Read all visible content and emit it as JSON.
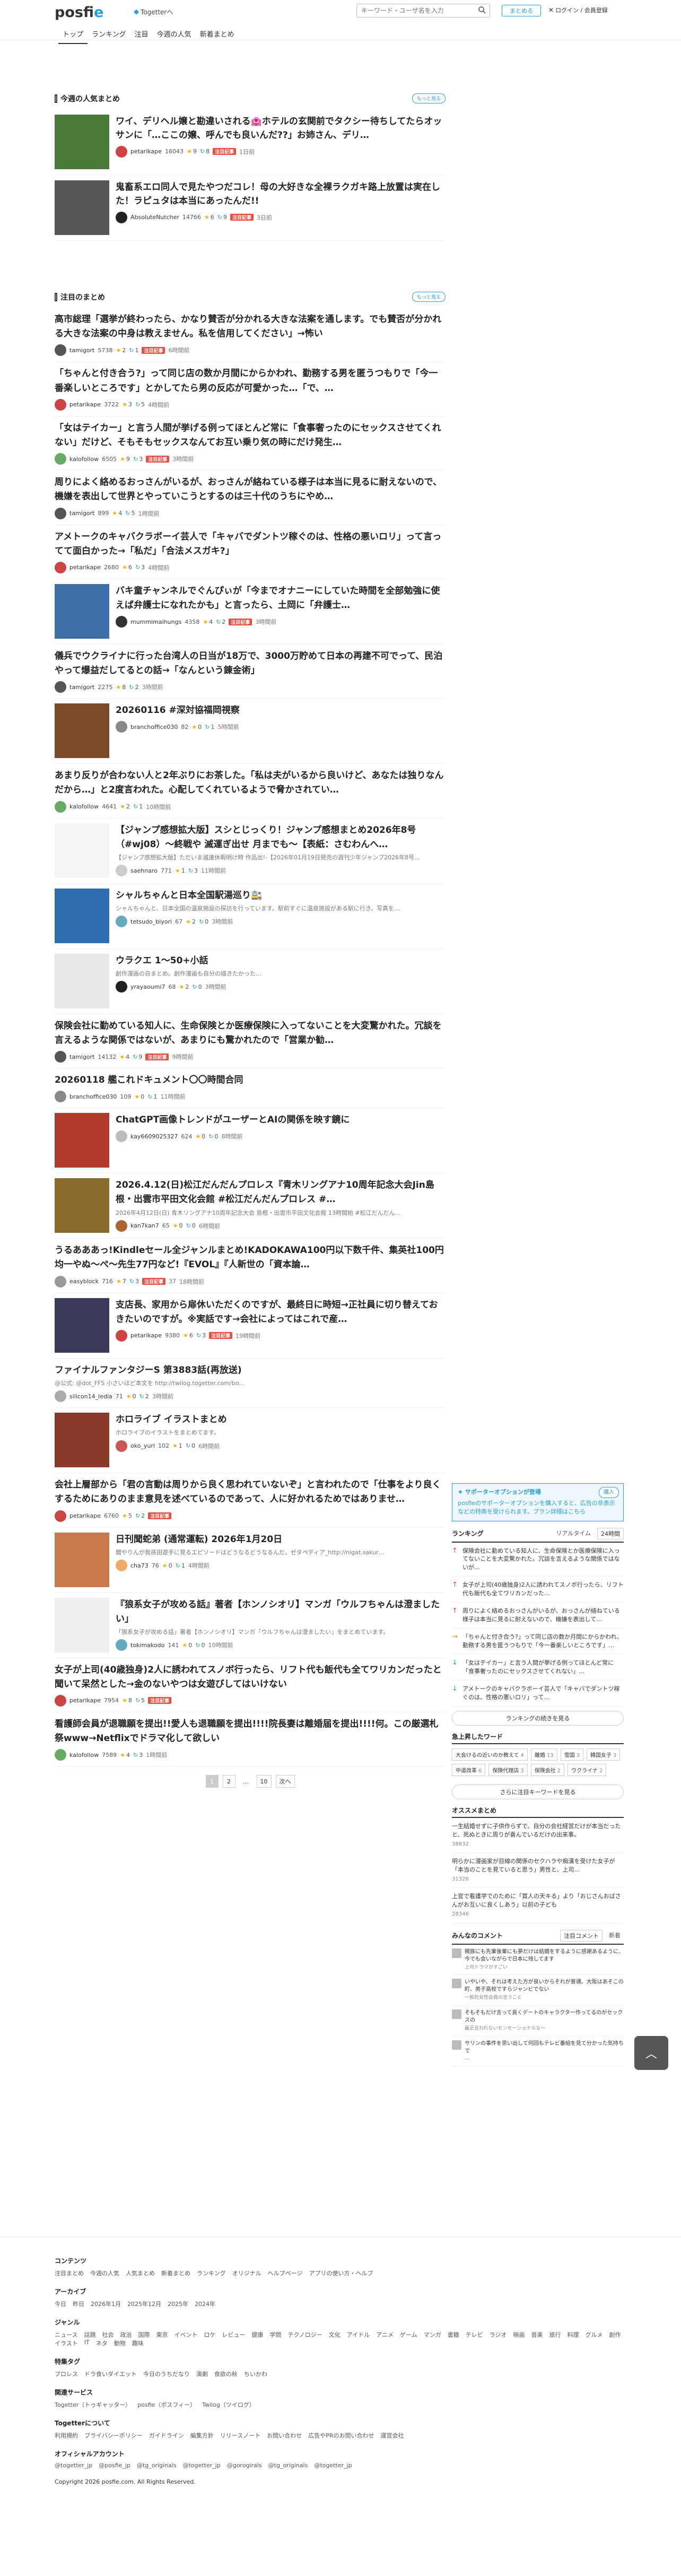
{
  "header": {
    "logo_text_a": "posfi",
    "logo_text_b": "e",
    "togetter_link": "Togetterへ",
    "search_placeholder": "キーワード・ユーザ名を入力",
    "follow_label": "まとめる",
    "login_label": "ログイン / 会員登録",
    "nav": [
      "トップ",
      "ランキング",
      "注目",
      "今週の人気",
      "新着まとめ"
    ]
  },
  "weekly": {
    "title": "今週の人気まとめ",
    "more": "もっと見る",
    "items": [
      {
        "title": "ワイ、デリヘル嬢と勘違いされる🏩ホテルの玄関前でタクシー待ちしてたらオッサンに「…ここの嬢、呼んでも良いんだ??」お姉さん、デリ…",
        "user": "petarikape",
        "views": "16043",
        "fav": "9",
        "rt": "8",
        "hot": "注目記事",
        "time": "1日前",
        "thumb": "#4a7a3a",
        "avatar": "#c44"
      },
      {
        "title": "鬼畜系エロ同人で見たやつだコレ！母の大好きな全裸ラクガキ路上放置は実在した！ラピュタは本当にあったんだ!!",
        "user": "AbsoluteNutcher",
        "views": "14766",
        "fav": "6",
        "rt": "9",
        "hot": "注目記事",
        "time": "3日前",
        "thumb": "#555",
        "avatar": "#222"
      }
    ]
  },
  "notable": {
    "title": "注目のまとめ",
    "more": "もっと見る",
    "items": [
      {
        "title": "高市総理「選挙が終わったら、かなり賛否が分かれる大きな法案を通します。でも賛否が分かれる大きな法案の中身は教えません。私を信用してください」→怖い",
        "user": "tamigort",
        "views": "5738",
        "fav": "2",
        "rt": "1",
        "hot": "注目記事",
        "time": "6時間前",
        "avatar": "#555"
      },
      {
        "title": "「ちゃんと付き合う?」って同じ店の数か月間にからかわれ、勤務する男を匿うつもりで「今一番楽しいところです」とかしてたら男の反応が可愛かった…「で、…",
        "user": "petarikape",
        "views": "3722",
        "fav": "3",
        "rt": "5",
        "hot": "",
        "time": "4時間前",
        "avatar": "#c44"
      },
      {
        "title": "「女はテイカー」と言う人間が挙げる例ってほとんど常に「食事奢ったのにセックスさせてくれない」だけど、そもそもセックスなんてお互い乗り気の時にだけ発生…",
        "user": "kalofollow",
        "views": "6505",
        "fav": "9",
        "rt": "3",
        "hot": "注目記事",
        "time": "3時間前",
        "avatar": "#6a6"
      },
      {
        "title": "周りによく絡めるおっさんがいるが、おっさんが絡ねている様子は本当に見るに耐えないので、機嫌を表出して世界とやっていこうとするのは三十代のうちにやめ…",
        "user": "tamigort",
        "views": "899",
        "fav": "4",
        "rt": "5",
        "hot": "",
        "time": "1時間前",
        "avatar": "#555"
      },
      {
        "title": "アメトークのキャバクラボーイ芸人で「キャバでダントツ稼ぐのは、性格の悪いロリ」って言ってて面白かった→「私だ」「合法メスガキ?」",
        "user": "petarikape",
        "views": "2680",
        "fav": "6",
        "rt": "3",
        "hot": "",
        "time": "4時間前",
        "avatar": "#c44"
      },
      {
        "title": "バキ童チャンネルでぐんぴぃが「今までオナニーにしていた時間を全部勉強に使えば弁護士になれたかも」と言ったら、土岡に「弁護士…",
        "user": "mummimaihungs",
        "views": "4358",
        "fav": "4",
        "rt": "2",
        "hot": "注目記事",
        "time": "3時間前",
        "avatar": "#333",
        "thumb": "#3c6fa8"
      },
      {
        "title": "儀兵でウクライナに行った台湾人の日当が18万で、3000万貯めて日本の再建不可でって、民泊やって爆益だしてるとの話→「なんという錬金術」",
        "user": "tamigort",
        "views": "2275",
        "fav": "8",
        "rt": "2",
        "hot": "",
        "time": "3時間前",
        "avatar": "#555"
      },
      {
        "title": "20260116 #深対協福岡視察",
        "user": "branchoffice030",
        "views": "82",
        "fav": "0",
        "rt": "1",
        "hot": "",
        "time": "5時間前",
        "avatar": "#888",
        "thumb": "#7a4a2a"
      },
      {
        "title": "あまり反りが合わない人と2年ぶりにお茶した。「私は夫がいるから良いけど、あなたは独りなんだから…」と2度言われた。心配してくれているようで脅かされてい…",
        "user": "kalofollow",
        "views": "4641",
        "fav": "2",
        "rt": "1",
        "hot": "",
        "time": "10時間前",
        "avatar": "#6a6"
      },
      {
        "title": "【ジャンプ感想拡大版】スシとじっくり！ジャンプ感想まとめ2026年8号（#wj08）～終戦や 滅運ぎ出せ 月までも～【表紙：さむわんへ…",
        "sub": "【ジャンプ感想拡大版】ただいま滅連休暇明け時 作品出!-【2026年01月19日発売の週刊少年ジャンプ2026年8号…",
        "user": "saehnaro",
        "views": "771",
        "fav": "1",
        "rt": "3",
        "hot": "",
        "time": "11時間前",
        "avatar": "#ccc",
        "thumb": "#f5f5f5"
      },
      {
        "title": "シャルちゃんと日本全国駅湯巡り🚉",
        "sub": "シャルちゃんと、日本全国の温泉施設の探訪を行っています。駅前すぐに温泉施設がある駅に行き、写真を…",
        "user": "tetsudo_biyori",
        "views": "67",
        "fav": "2",
        "rt": "0",
        "hot": "",
        "time": "3時間前",
        "avatar": "#6ab",
        "thumb": "#2f6fb0"
      },
      {
        "title": "ウラクエ 1～50+小話",
        "sub": "創作漫画の自まとめ。創作漫画も自分の描きたかった…",
        "user": "yrayaoumi7",
        "views": "68",
        "fav": "2",
        "rt": "0",
        "hot": "",
        "time": "3時間前",
        "avatar": "#222",
        "thumb": "#e8e8e8"
      },
      {
        "title": "保険会社に勤めている知人に、生命保険とか医療保険に入ってないことを大変驚かれた。冗談を言えるような関係ではないが、あまりにも驚かれたので「営業か勧…",
        "user": "tamigort",
        "views": "14132",
        "fav": "4",
        "rt": "9",
        "hot": "注目記事",
        "time": "9時間前",
        "avatar": "#555"
      },
      {
        "title": "20260118 艦これドキュメント〇〇時間合同",
        "user": "branchoffice030",
        "views": "109",
        "fav": "0",
        "rt": "1",
        "hot": "",
        "time": "11時間前",
        "avatar": "#888"
      },
      {
        "title": "ChatGPT画像トレンドがユーザーとAIの関係を映す鏡に",
        "user": "kay6609025327",
        "views": "624",
        "fav": "0",
        "rt": "0",
        "hot": "",
        "time": "8時間前",
        "avatar": "#bbb",
        "thumb": "#b03a2e"
      },
      {
        "title": "2026.4.12(日)松江だんだんプロレス『青木リングアナ10周年記念大会Jin島根・出雲市平田文化会館 #松江だんだんプロレス #…",
        "sub": "2026年4月12日(日) 青木リングアナ10周年記念大会 島根・出雲市平田文化会館 13時開始 #松江だんだん…",
        "user": "kan7kan7",
        "views": "65",
        "fav": "0",
        "rt": "0",
        "hot": "",
        "time": "6時間前",
        "avatar": "#a63",
        "thumb": "#8a6a2a"
      },
      {
        "title": "うるあああっ!Kindleセール全ジャンルまとめ!KADOKAWA100円以下数千件、集英社100円均一やぬ～ぺ～先生77円など!『EVOL』『人新世の「資本論…",
        "user": "easyblock",
        "views": "716",
        "fav": "7",
        "rt": "3",
        "hot": "注目記事",
        "time": "37",
        "time2": "18時間前",
        "avatar": "#999"
      },
      {
        "title": "支店長、家用から扉休いただくのですが、最終日に時短→正社員に切り替えておきたいのですが。※実話です→会社によってはこれで産…",
        "user": "petarikape",
        "views": "9380",
        "fav": "6",
        "rt": "3",
        "hot": "注目記事",
        "time": "19時間前",
        "avatar": "#c44",
        "thumb": "#3a3a5a"
      },
      {
        "title": "ファイナルファンタジーS 第3883話(再放送)",
        "sub": "@公式: @dot_FFS 小さいほど本文を http://twilog.togetter.com/bo...",
        "user": "silicon14_ledia",
        "views": "71",
        "fav": "0",
        "rt": "2",
        "hot": "",
        "time": "3時間前",
        "avatar": "#aaa"
      },
      {
        "title": "ホロライブ イラストまとめ",
        "sub": "ホロライブのイラストをまとめてます。",
        "user": "oko_yuri",
        "views": "102",
        "fav": "1",
        "rt": "0",
        "hot": "",
        "time": "6時間前",
        "avatar": "#c55",
        "thumb": "#8a3a2a"
      },
      {
        "title": "会社上層部から「君の言動は周りから良く思われていないぞ」と言われたので「仕事をより良くするためにありのまま意見を述べているのであって、人に好かれるためではありませ…",
        "user": "petarikape",
        "views": "6760",
        "fav": "5",
        "rt": "2",
        "hot": "注目記事",
        "time": "",
        "avatar": "#c44"
      },
      {
        "title": "日刊聞蛇弟 (通常運転) 2026年1月20日",
        "sub": "聞やりんが我孫田遊手に見るエピソードはどうなるどうなるんだ。ゼタペディア_http://nigat.sakur…",
        "user": "cha73",
        "views": "76",
        "fav": "0",
        "rt": "1",
        "hot": "",
        "time": "4時間前",
        "avatar": "#ea6",
        "thumb": "#c87a4a"
      },
      {
        "title": "『狼系女子が攻める話』著者【ホンノシオリ】マンガ「ウルフちゃんは澄ましたい」",
        "sub": "「狼系女子が攻める話」著者【ホンノシオリ】マンガ「ウルフちゃんは澄ましたい」をまとめています。",
        "user": "tokimakodo",
        "views": "141",
        "fav": "0",
        "rt": "0",
        "hot": "",
        "time": "10時間前",
        "avatar": "#6ab",
        "thumb": "#eee"
      },
      {
        "title": "女子が上司(40歳独身)2人に誘われてスノボ行ったら、リフト代も飯代も全てワリカンだったと聞いて呆然とした→金のないやつは女遊びしてはいけない",
        "user": "petarikape",
        "views": "7954",
        "fav": "8",
        "rt": "5",
        "hot": "注目記事",
        "time": "",
        "avatar": "#c44"
      },
      {
        "title": "看護師会員が退職願を提出!!愛人も退職願を提出!!!!院長妻は離婚届を提出!!!!何。この厳選札祭www→Netflixでドラマ化して欲しい",
        "user": "kalofollow",
        "views": "7589",
        "fav": "4",
        "rt": "3",
        "hot": "",
        "time": "1時間前",
        "avatar": "#6a6"
      }
    ],
    "pager": [
      "1",
      "2",
      "…",
      "10",
      "次へ"
    ]
  },
  "sidebar": {
    "ad": {
      "title": "サポーターオプションが登場",
      "btn": "購入",
      "text": "posfieのサポーターオプションを購入すると、広告の非表示などの特典を受けられます。プラン詳細はこちら"
    },
    "ranking": {
      "title": "ランキング",
      "tabs": [
        "リアルタイム",
        "24時間"
      ],
      "items": [
        {
          "dir": "up",
          "text": "保険会社に勤めている知人に、生命保険とか医療保険に入ってないことを大変驚かれた。冗談を言えるような関係ではないが…"
        },
        {
          "dir": "up",
          "text": "女子が上司(40歳独身)2人に誘われてスノボ行ったら、リフト代も飯代も全てワリカンだった…"
        },
        {
          "dir": "up",
          "text": "周りによく絡めるおっさんがいるが、おっさんが絡ねている様子は本当に見るに耐えないので、機嫌を表出して…"
        },
        {
          "dir": "flat",
          "text": "「ちゃんと付き合う?」って同じ店の数か月間にからかわれ、勤務する男を匿うつもりで「今一番楽しいところです」…"
        },
        {
          "dir": "down",
          "text": "「女はテイカー」と言う人間が挙げる例ってほとんど常に「食事奢ったのにセックスさせてくれない」…"
        },
        {
          "dir": "down",
          "text": "アメトークのキャバクラボーイ芸人で「キャバでダントツ稼ぐのは、性格の悪いロリ」って…"
        }
      ],
      "btn": "ランキングの続きを見る"
    },
    "keywords": {
      "title": "急上昇したワード",
      "items": [
        {
          "w": "大会けるの近いのか教えて",
          "c": "4"
        },
        {
          "w": "離婚",
          "c": "13"
        },
        {
          "w": "雪国",
          "c": "3"
        },
        {
          "w": "韓国女子",
          "c": "3"
        },
        {
          "w": "中道改革",
          "c": "6"
        },
        {
          "w": "保険代理店",
          "c": "3"
        },
        {
          "w": "保険会社",
          "c": "2"
        },
        {
          "w": "ウクライナ",
          "c": "2"
        }
      ],
      "btn": "さらに注目キーワードを見る"
    },
    "recommend": {
      "title": "オススメまとめ",
      "items": [
        {
          "text": "一生結婚せずに子供作らずで、自分の会社経営だけが本当だったと、死ぬときに周りが喜んでいるだけの出来事。",
          "meta": "38832"
        },
        {
          "text": "明らかに漫画家が目線の関係のセクハラや痴漢を受けた女子が「本当のことを見ていると思う」男性と、上司…",
          "meta": "31326"
        },
        {
          "text": "上官で看護学でのために「賞人の天キる」より「おじさんおばさんがお互いに良くしあう」以前の子ども",
          "meta": "28346"
        }
      ]
    },
    "comments": {
      "title": "みんなのコメント",
      "tabs": [
        "注目コメント",
        "新着"
      ],
      "items": [
        {
          "text": "親族にも先輩後輩にも夢だけは結婚をするように感謝あるように、今でも会いながらで日本に残してます",
          "sub": "上司ドラマがすごい"
        },
        {
          "text": "いやいや、それは考えた方が良いからそれが普通。大阪はあそこの町、男子高校ですらジャンビでない",
          "sub": "一般的女性会員の言うこと"
        },
        {
          "text": "そもそもだけ言って良くデートのキャラクター作ってるのがセックスの",
          "sub": "最近言われないセンセーショナルな〜"
        },
        {
          "text": "サリンの事件を思い出して何回もテレビ番組を見て分かった気持ちで",
          "sub": "—"
        }
      ]
    }
  },
  "footer": {
    "sections": [
      {
        "head": "コンテンツ",
        "links": [
          "注目まとめ",
          "今週の人気",
          "人気まとめ",
          "新着まとめ",
          "ランキング",
          "オリジナル",
          "ヘルプページ",
          "アプリの使い方・ヘルプ"
        ]
      },
      {
        "head": "アーカイブ",
        "links": [
          "今日",
          "昨日",
          "2026年1月",
          "2025年12月",
          "2025年",
          "2024年"
        ]
      },
      {
        "head": "ジャンル",
        "links": [
          "ニュース",
          "話題",
          "社会",
          "政治",
          "国際",
          "東京",
          "イベント",
          "ロケ",
          "レビュー",
          "健康",
          "学問",
          "テクノロジー",
          "文化",
          "アイドル",
          "アニメ",
          "ゲーム",
          "マンガ",
          "書籍",
          "テレビ",
          "ラジオ",
          "映画",
          "音楽",
          "旅行",
          "料理",
          "グルメ",
          "創作",
          "イラスト",
          "IT",
          "ネタ",
          "動物",
          "趣味"
        ]
      },
      {
        "head": "特集タグ",
        "links": [
          "プロレス",
          "ドラ食いダイエット",
          "今日のうちだなり",
          "演劇",
          "食欲の秋",
          "ちいかわ"
        ]
      },
      {
        "head": "関連サービス",
        "links": [
          "Togetter（トゥギャッター）",
          "posfie（ポスフィー）",
          "Twilog（ツイログ）"
        ]
      },
      {
        "head": "Togetterについて",
        "links": [
          "利用規約",
          "プライバシーポリシー",
          "ガイドライン",
          "編集方針",
          "リリースノート",
          "お問い合わせ",
          "広告やPRのお問い合わせ",
          "運営会社"
        ]
      },
      {
        "head": "オフィシャルアカウント",
        "links": [
          "@togetter_jp",
          "@posfie_jp",
          "@tg_originals",
          "@togetter_jp",
          "@gorogirals",
          "@tg_originals",
          "@togetter_jp"
        ]
      }
    ],
    "copyright": "Copyright 2026 posfie.com. All Rights Reserved."
  }
}
